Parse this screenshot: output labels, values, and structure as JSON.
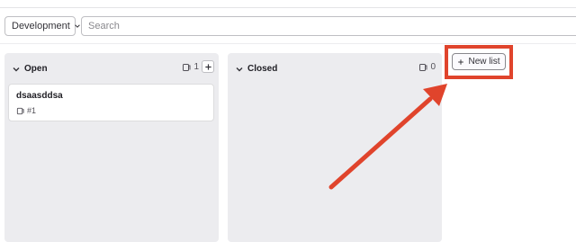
{
  "filter": {
    "dropdown_label": "Development",
    "search_placeholder": "Search",
    "search_value": ""
  },
  "lists": [
    {
      "title": "Open",
      "count": "1",
      "cards": [
        {
          "title": "dsaasddsa",
          "ref": "#1"
        }
      ]
    },
    {
      "title": "Closed",
      "count": "0",
      "cards": []
    }
  ],
  "new_list_button": {
    "label": "New list"
  },
  "annotation": {
    "color": "#e0442c"
  },
  "colors": {
    "list_background": "#ececef",
    "accent_red": "#e0442c"
  }
}
